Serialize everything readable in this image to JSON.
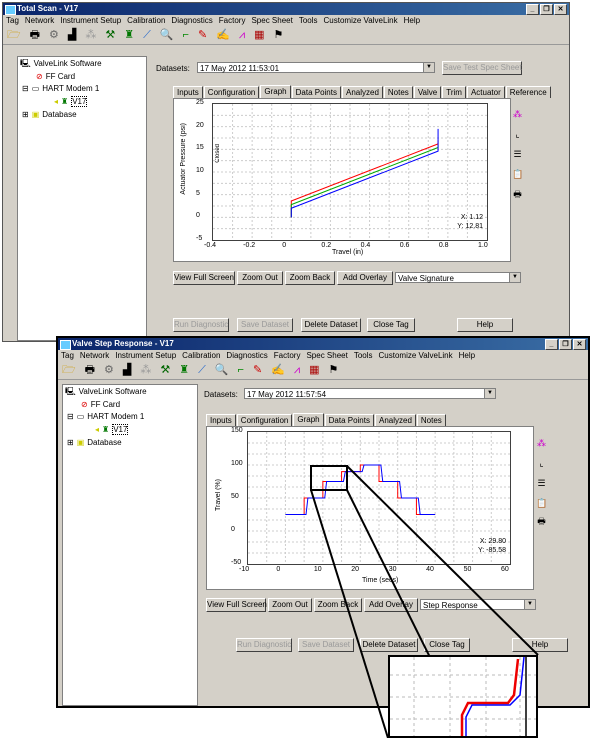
{
  "menu": [
    "Tag",
    "Network",
    "Instrument Setup",
    "Calibration",
    "Diagnostics",
    "Factory",
    "Spec Sheet",
    "Tools",
    "Customize ValveLink",
    "Help"
  ],
  "toolbar_icons": [
    "open-folder-icon",
    "printer-icon",
    "instrument-icon",
    "trend-icon",
    "network-icon",
    "wrench-icon",
    "valve-icon",
    "probe-icon",
    "search-icon",
    "step-icon",
    "pencil-icon",
    "signature-icon",
    "chart-icon",
    "spec-icon",
    "checkered-flag-icon"
  ],
  "tree": {
    "root": "ValveLink Software",
    "ff": "FF Card",
    "modem": "HART Modem 1",
    "device": "V17",
    "db": "Database"
  },
  "w1": {
    "title": "Total Scan - V17",
    "datasets_label": "Datasets:",
    "dataset": "17 May 2012 11:53:01",
    "spec_button": "Save Test Spec Sheet",
    "tabs": [
      "Inputs",
      "Configuration",
      "Graph",
      "Data Points",
      "Analyzed",
      "Notes",
      "Valve",
      "Trim",
      "Actuator",
      "Reference"
    ],
    "active_tab": "Graph",
    "xlabel": "Travel (in)",
    "ylabel": "Actuator Pressure (psi)",
    "ytag": "Closed",
    "xticks": [
      "-0.4",
      "-0.2",
      "0",
      "0.2",
      "0.4",
      "0.6",
      "0.8",
      "1.0"
    ],
    "yticks": [
      "25",
      "20",
      "15",
      "10",
      "5",
      "0",
      "-5"
    ],
    "readout_x": "X:  1.12",
    "readout_y": "Y:  12.81",
    "buttons": {
      "full": "View Full Screen",
      "zoomout": "Zoom Out",
      "zoomback": "Zoom Back",
      "overlay": "Add Overlay",
      "select": "Valve Signature"
    },
    "bottom": {
      "run": "Run Diagnostic",
      "save": "Save Dataset",
      "delete": "Delete Dataset",
      "close": "Close Tag",
      "help": "Help"
    }
  },
  "w2": {
    "title": "Valve Step Response - V17",
    "datasets_label": "Datasets:",
    "dataset": "17 May 2012 11:57:54",
    "tabs": [
      "Inputs",
      "Configuration",
      "Graph",
      "Data Points",
      "Analyzed",
      "Notes"
    ],
    "active_tab": "Graph",
    "xlabel": "Time (secs)",
    "ylabel": "Travel (%)",
    "xticks": [
      "-10",
      "0",
      "10",
      "20",
      "30",
      "40",
      "50",
      "60"
    ],
    "yticks": [
      "150",
      "100",
      "50",
      "0",
      "-50"
    ],
    "readout_x": "X:  29.80",
    "readout_y": "Y:  -85.58",
    "buttons": {
      "full": "View Full Screen",
      "zoomout": "Zoom Out",
      "zoomback": "Zoom Back",
      "overlay": "Add Overlay",
      "select": "Step Response"
    },
    "bottom": {
      "run": "Run Diagnostic",
      "save": "Save Dataset",
      "delete": "Delete Dataset",
      "close": "Close Tag",
      "help": "Help"
    }
  },
  "chart_data": [
    {
      "type": "line",
      "xlabel": "Travel (in)",
      "ylabel": "Actuator Pressure (psi)",
      "xlim": [
        -0.4,
        1.0
      ],
      "ylim": [
        -5,
        25
      ],
      "colors": [
        "#ff0000",
        "#00aa00",
        "#0000ff"
      ],
      "series": [
        {
          "x": [
            0,
            0,
            0.75,
            0.75
          ],
          "values": [
            0,
            3.6,
            16.2,
            17
          ]
        },
        {
          "x": [
            0,
            0,
            0.75,
            0.75
          ],
          "values": [
            0,
            2.8,
            15.4,
            16
          ]
        },
        {
          "x": [
            0,
            0,
            0.75,
            0.75
          ],
          "values": [
            0,
            2.0,
            14.6,
            19.5
          ]
        }
      ]
    },
    {
      "type": "line",
      "xlabel": "Time (secs)",
      "ylabel": "Travel (%)",
      "xlim": [
        -10,
        60
      ],
      "ylim": [
        -50,
        150
      ],
      "colors": [
        "#ff0000",
        "#0000ff"
      ],
      "series": [
        {
          "x": [
            0,
            0,
            5,
            5,
            10,
            10,
            15,
            15,
            20,
            20,
            25,
            25,
            30,
            30,
            35,
            35,
            40,
            40
          ],
          "values": [
            25,
            25,
            25,
            50,
            50,
            75,
            75,
            90,
            90,
            100,
            100,
            75,
            75,
            50,
            50,
            25,
            25,
            25
          ]
        },
        {
          "x": [
            0,
            0,
            5.5,
            6,
            10.5,
            11,
            15.5,
            16,
            20.5,
            21,
            25.5,
            26,
            30.5,
            31,
            35.5,
            36,
            40,
            40
          ],
          "values": [
            25,
            25,
            25,
            50,
            50,
            75,
            75,
            90,
            90,
            100,
            100,
            75,
            75,
            50,
            50,
            25,
            25,
            25
          ]
        }
      ]
    }
  ]
}
